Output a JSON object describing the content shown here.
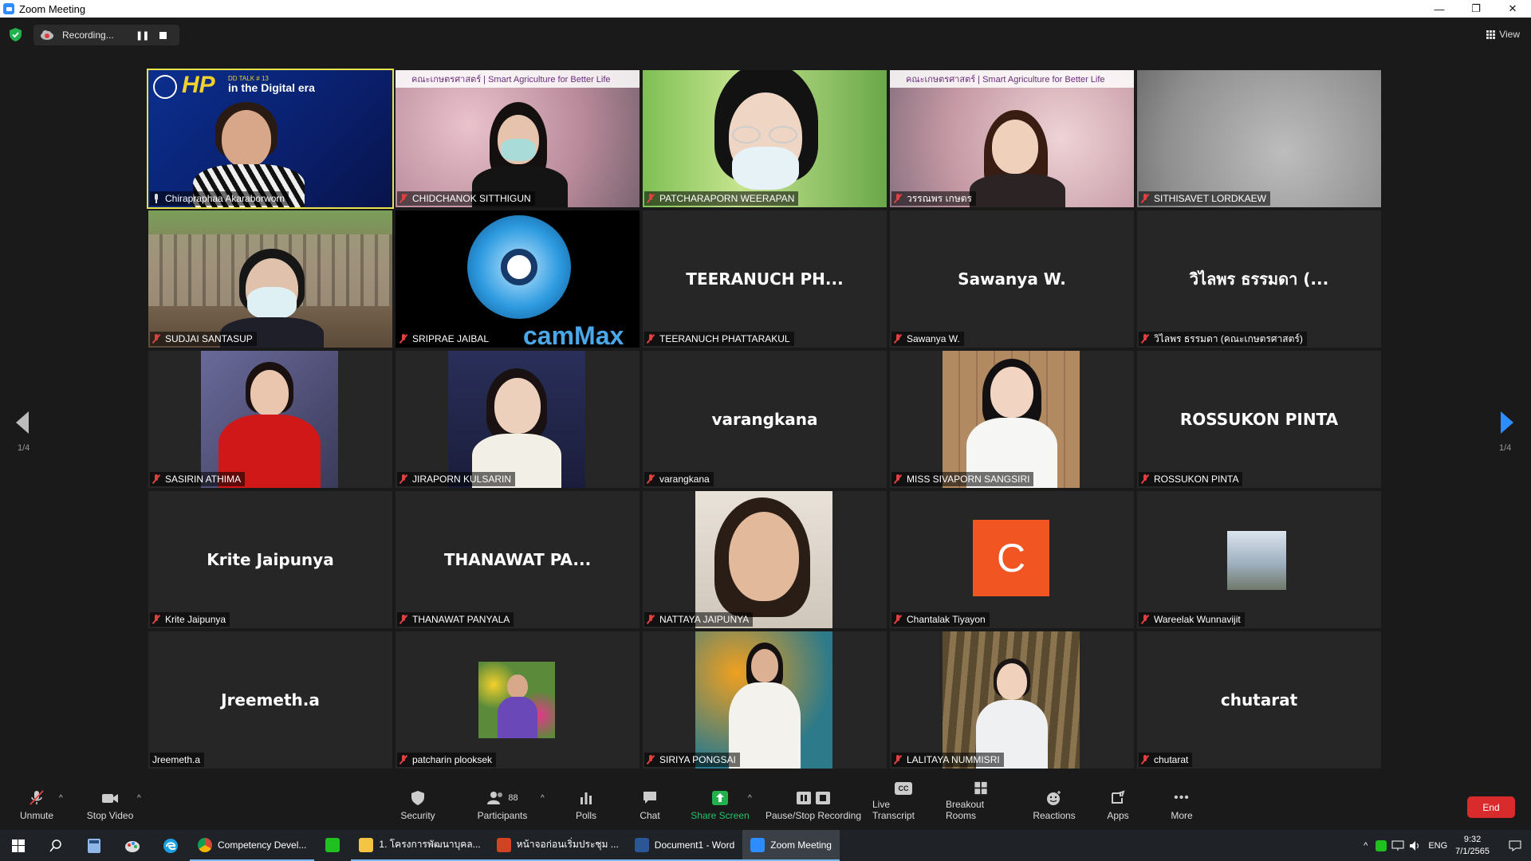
{
  "window": {
    "title": "Zoom Meeting",
    "minimize": "—",
    "restore": "❐",
    "close": "✕"
  },
  "top": {
    "recording_label": "Recording...",
    "view_label": "View"
  },
  "colors": {
    "accent_blue": "#2d8cff",
    "end_red": "#d92b2b",
    "active_speaker": "#e8e34c",
    "mic_muted": "#e04040",
    "avatar_orange": "#f05522"
  },
  "page_indicator": {
    "left": "1/4",
    "right": "1/4"
  },
  "participants": [
    {
      "name": "Chirapraphaa Akaraborworn",
      "display": "Chirapraphaa Akaraborworn",
      "muted": false,
      "active": true,
      "video": "speaker-hp",
      "banner_title": "DD TALK # 13",
      "banner_sub": "in the Digital era",
      "logo_text": "HP"
    },
    {
      "name": "CHIDCHANOK SITTHIGUN",
      "display": "CHIDCHANOK SITTHIGUN",
      "muted": true,
      "video": "blossom-mask",
      "banner": "คณะเกษตรศาสตร์ | Smart Agriculture for Better Life"
    },
    {
      "name": "PATCHARAPORN WEERAPAN",
      "display": "PATCHARAPORN WEERAPAN",
      "muted": true,
      "video": "grass-mask"
    },
    {
      "name": "วรรณพร เกษตร",
      "display": "วรรณพร เกษตร",
      "muted": true,
      "video": "blossom-woman",
      "banner": "คณะเกษตรศาสตร์ | Smart Agriculture for Better Life"
    },
    {
      "name": "SITHISAVET LORDKAEW",
      "display": "SITHISAVET LORDKAEW",
      "muted": true,
      "video": "grey"
    },
    {
      "name": "SUDJAI SANTASUP",
      "display": "SUDJAI SANTASUP",
      "muted": true,
      "video": "building-mask"
    },
    {
      "name": "SRIPRAE JAIBAL",
      "display": "SRIPRAE JAIBAL",
      "muted": true,
      "video": "webcammax",
      "overlay_text": "camMax"
    },
    {
      "name": "TEERANUCH PHATTARAKUL",
      "display": "TEERANUCH PH...",
      "muted": true,
      "video": "none"
    },
    {
      "name": "Sawanya W.",
      "display": "Sawanya W.",
      "muted": true,
      "video": "none"
    },
    {
      "name": "วิไลพร ธรรมดา (คณะเกษตรศาสตร์)",
      "display": "วิไลพร ธรรมดา (...",
      "muted": true,
      "video": "none"
    },
    {
      "name": "SASIRIN ATHIMA",
      "display": "SASIRIN ATHIMA",
      "muted": true,
      "video": "photo-red"
    },
    {
      "name": "JIRAPORN KULSARIN",
      "display": "JIRAPORN KULSARIN",
      "muted": true,
      "video": "photo-navy"
    },
    {
      "name": "varangkana",
      "display": "varangkana",
      "muted": true,
      "video": "none"
    },
    {
      "name": "MISS SIVAPORN SANGSIRI",
      "display": "MISS SIVAPORN SANGSIRI",
      "muted": true,
      "video": "photo-wood"
    },
    {
      "name": "ROSSUKON PINTA",
      "display": "ROSSUKON PINTA",
      "muted": true,
      "video": "none"
    },
    {
      "name": "Krite Jaipunya",
      "display": "Krite Jaipunya",
      "muted": true,
      "video": "none"
    },
    {
      "name": "THANAWAT PANYALA",
      "display": "THANAWAT PA...",
      "muted": true,
      "video": "none"
    },
    {
      "name": "NATTAYA JAIPUNYA",
      "display": "NATTAYA JAIPUNYA",
      "muted": true,
      "video": "photo-selfie"
    },
    {
      "name": "Chantalak Tiyayon",
      "display": "Chantalak Tiyayon",
      "muted": true,
      "video": "avatar-c",
      "avatar_letter": "C"
    },
    {
      "name": "Wareelak Wunnavijit",
      "display": "Wareelak Wunnavijit",
      "muted": true,
      "video": "small-landscape"
    },
    {
      "name": "Jreemeth.a",
      "display": "Jreemeth.a",
      "muted": false,
      "video": "none"
    },
    {
      "name": "patcharin plooksek",
      "display": "patcharin plooksek",
      "muted": true,
      "video": "small-flowers"
    },
    {
      "name": "SIRIYA PONGSAI",
      "display": "SIRIYA PONGSAI",
      "muted": true,
      "video": "photo-autumn"
    },
    {
      "name": "LALITAYA NUMMISRI",
      "display": "LALITAYA NUMMISRI",
      "muted": true,
      "video": "photo-tree"
    },
    {
      "name": "chutarat",
      "display": "chutarat",
      "muted": true,
      "video": "none"
    }
  ],
  "toolbar": {
    "unmute": "Unmute",
    "stop_video": "Stop Video",
    "security": "Security",
    "participants": "Participants",
    "participants_count": "88",
    "polls": "Polls",
    "chat": "Chat",
    "share_screen": "Share Screen",
    "pause_recording": "Pause/Stop Recording",
    "live_transcript": "Live Transcript",
    "breakout_rooms": "Breakout Rooms",
    "reactions": "Reactions",
    "apps": "Apps",
    "more": "More",
    "end": "End",
    "cc": "CC"
  },
  "taskbar": {
    "apps": [
      {
        "label": "Competency Devel...",
        "icon": "chrome-icon"
      },
      {
        "label": "",
        "icon": "line-icon"
      },
      {
        "label": "1. โครงการพัฒนาบุคล...",
        "icon": "folder-icon"
      },
      {
        "label": "หน้าจอก่อนเริ่มประชุม ...",
        "icon": "powerpoint-icon"
      },
      {
        "label": "Document1 - Word",
        "icon": "word-icon"
      },
      {
        "label": "Zoom Meeting",
        "icon": "zoom-icon"
      }
    ],
    "lang": "ENG",
    "time": "9:32",
    "date": "7/1/2565"
  }
}
